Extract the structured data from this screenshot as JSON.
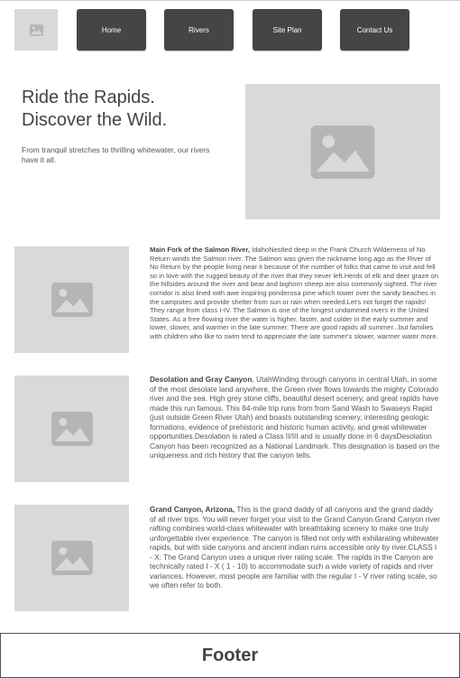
{
  "nav": {
    "items": [
      {
        "label": "Home"
      },
      {
        "label": "Rivers"
      },
      {
        "label": "Site Plan"
      },
      {
        "label": "Contact Us"
      }
    ]
  },
  "logo": {
    "icon": "image-placeholder-icon"
  },
  "hero": {
    "title_line1": "Ride the Rapids.",
    "title_line2": "Discover the Wild.",
    "subtitle": "From tranquil stretches to thrilling whitewater, our rivers have it all."
  },
  "rivers": [
    {
      "name": "Main Fork of the Salmon River,",
      "description": " IdahoNestled deep in the Frank Church Wilderness of No Return winds the Salmon river. The Salmon was given the nickname long ago as the River of No Return by the people living near it because of the number of folks that came to visit and fell so in love with the rugged beauty of the river that they never left.Herds of elk and deer graze on the hillsides around the river and bear and bighorn sheep are also commonly sighted. The river corridor is also lined with awe inspiring ponderosa pine which tower over the sandy beaches in the campsites and provide shelter from sun or rain when needed.Let's not forget the rapids! They range from class I-IV. The Salmon is one of the longest undammed rivers in the United States. As a free flowing river the water is higher, faster, and colder in the early summer and lower, slower, and warmer in the late summer. There are good rapids all summer...but families with children who like to swim tend to appreciate the late summer's slower, warmer water more."
    },
    {
      "name": "Desolation and Gray Canyon",
      "description": ", UtahWinding through canyons in central Utah, in some of the most desolate land anywhere, the Green river flows towards the mighty Colorado river and the sea. High grey stone cliffs, beautiful desert scenery, and great rapids have made this run famous. This 84-mile trip runs from from Sand Wash to Swaseys Rapid (just outside Green River Utah) and boasts outstanding scenery, interesting geologic formations, evidence of prehistoric and historic human activity, and great whitewater opportunities.Desolation is rated a Class II/III and is usually done in 6 daysDesolation Canyon has been recognized as a National Landmark.  This designation is based on the uniqueness and rich history that the canyon tells."
    },
    {
      "name": "Grand Canyon, Arizona,",
      "description": "  This is the grand daddy of all canyons and the grand daddy of all river trips. You will never forget your visit to the Grand Canyon.Grand Canyon river rafting combines world-class whitewater with breathtaking scenery to make one truly unforgettable river experience. The canyon is filled not only with exhilarating whitewater rapids, but with side canyons and ancient indian ruins accessible only by river.CLASS I - X: The Grand Canyon uses a unique river rating scale. The rapids in the Canyon are technically rated I - X ( 1 - 10) to accommodate such a wide variety of rapids and river variances. However, most people are familiar with the regular I - V river rating scale, so we often refer to both."
    }
  ],
  "footer": {
    "label": "Footer"
  }
}
